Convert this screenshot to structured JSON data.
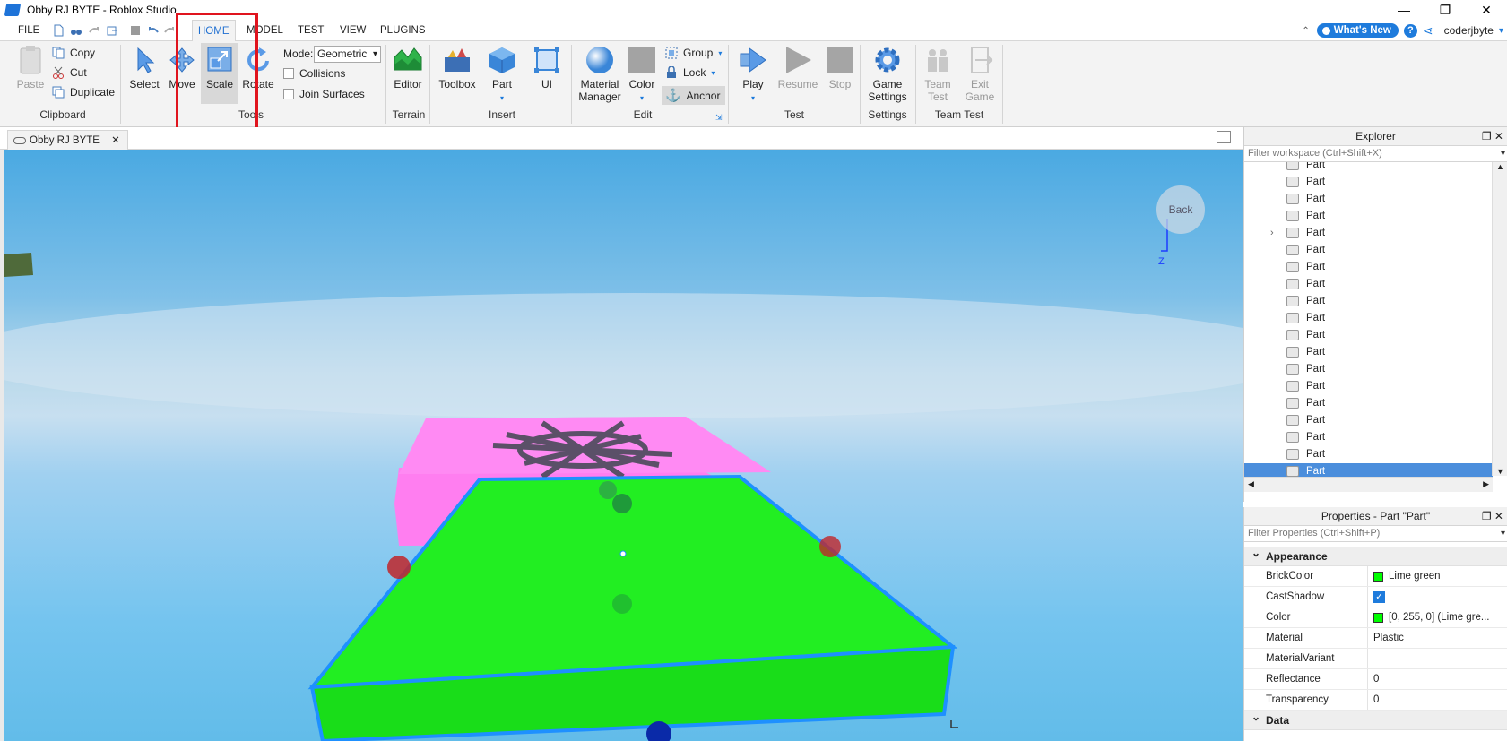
{
  "window": {
    "title": "Obby RJ BYTE - Roblox Studio",
    "minimize": "—",
    "maximize": "❐",
    "close": "✕"
  },
  "menu": {
    "file": "FILE",
    "tabs": [
      "HOME",
      "MODEL",
      "TEST",
      "VIEW",
      "PLUGINS"
    ],
    "whats_new": "What's New",
    "help": "?",
    "username": "coderjbyte"
  },
  "ribbon": {
    "clipboard": {
      "paste": "Paste",
      "copy": "Copy",
      "cut": "Cut",
      "duplicate": "Duplicate",
      "label": "Clipboard"
    },
    "tools": {
      "select": "Select",
      "move": "Move",
      "scale": "Scale",
      "rotate": "Rotate",
      "mode_label": "Mode:",
      "mode_value": "Geometric",
      "collisions": "Collisions",
      "join_surfaces": "Join Surfaces",
      "label": "Tools"
    },
    "terrain": {
      "editor": "Editor",
      "label": "Terrain"
    },
    "insert": {
      "toolbox": "Toolbox",
      "part": "Part",
      "ui": "UI",
      "label": "Insert"
    },
    "edit": {
      "material_1": "Material",
      "material_2": "Manager",
      "color": "Color",
      "group": "Group",
      "lock": "Lock",
      "anchor": "Anchor",
      "label": "Edit"
    },
    "test": {
      "play": "Play",
      "resume": "Resume",
      "stop": "Stop",
      "label": "Test"
    },
    "settings": {
      "game_1": "Game",
      "game_2": "Settings",
      "label": "Settings"
    },
    "team_test": {
      "team_1": "Team",
      "team_2": "Test",
      "exit_1": "Exit",
      "exit_2": "Game",
      "label": "Team Test"
    }
  },
  "doc_tab": {
    "name": "Obby RJ BYTE",
    "close": "✕"
  },
  "viewport": {
    "back": "Back"
  },
  "explorer": {
    "title": "Explorer",
    "filter_placeholder": "Filter workspace (Ctrl+Shift+X)",
    "items": [
      "Part",
      "Part",
      "Part",
      "Part",
      "Part",
      "Part",
      "Part",
      "Part",
      "Part",
      "Part",
      "Part",
      "Part",
      "Part",
      "Part",
      "Part",
      "Part",
      "Part",
      "Part",
      "Part"
    ]
  },
  "properties": {
    "title": "Properties - Part \"Part\"",
    "filter_placeholder": "Filter Properties (Ctrl+Shift+P)",
    "category_appearance": "Appearance",
    "category_data": "Data",
    "rows": {
      "brickcolor": {
        "key": "BrickColor",
        "value": "Lime green"
      },
      "castshadow": {
        "key": "CastShadow",
        "value": "✓"
      },
      "color": {
        "key": "Color",
        "value": "[0, 255, 0] (Lime gre..."
      },
      "material": {
        "key": "Material",
        "value": "Plastic"
      },
      "materialvariant": {
        "key": "MaterialVariant",
        "value": ""
      },
      "reflectance": {
        "key": "Reflectance",
        "value": "0"
      },
      "transparency": {
        "key": "Transparency",
        "value": "0"
      }
    }
  },
  "colors": {
    "accent": "#1e7bdc",
    "highlight": "#e0141e",
    "lime": "#00ff00",
    "pink": "#ff7ef0"
  }
}
